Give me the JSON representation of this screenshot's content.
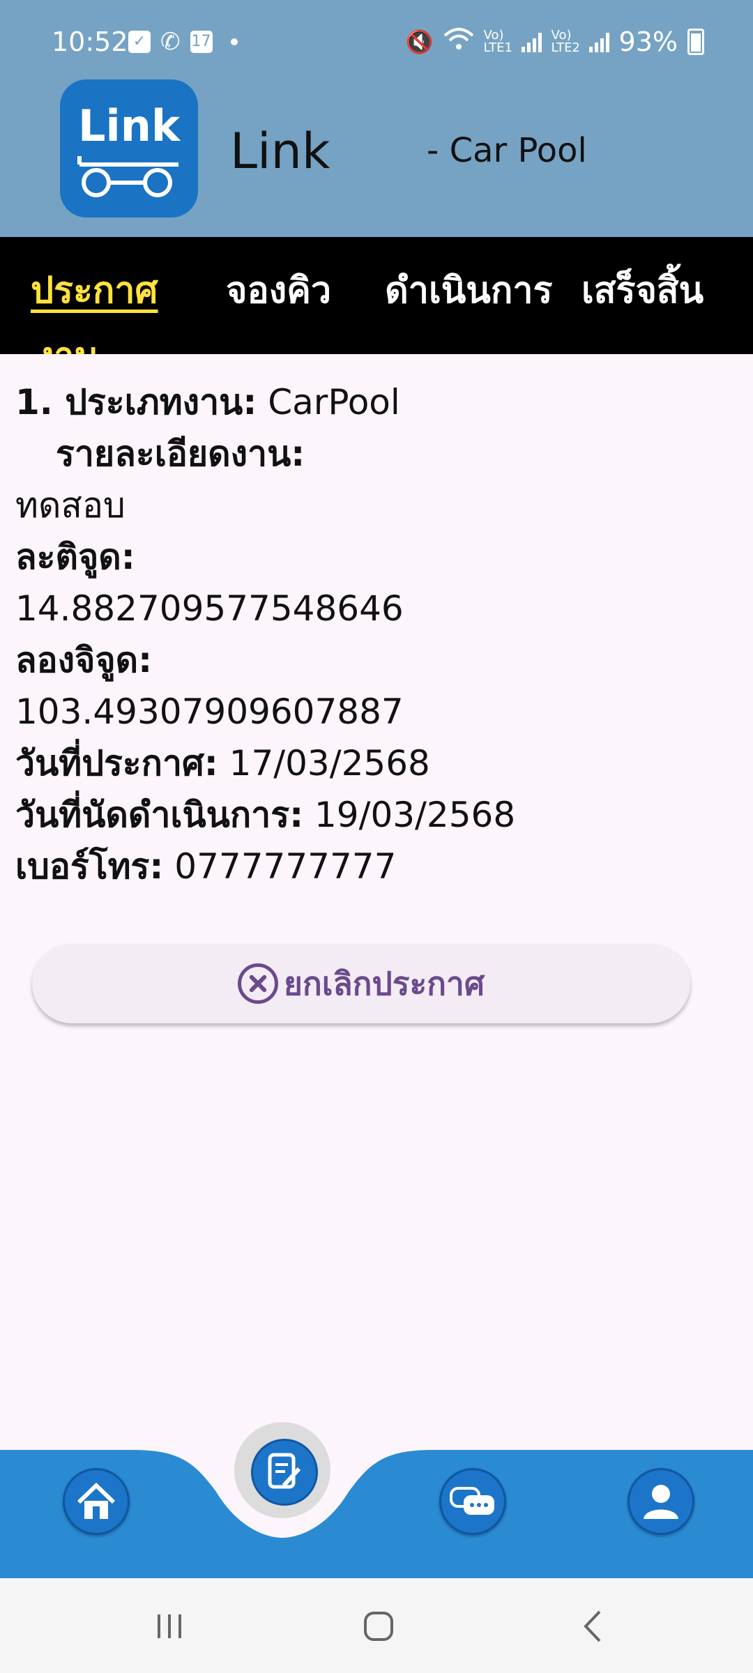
{
  "status_bar": {
    "time": "10:52",
    "calendar_day": "17",
    "lte1": "Vo) LTE1",
    "lte2": "Vo) LTE2",
    "battery": "93%"
  },
  "header": {
    "logo_text": "Link",
    "app_name": "Link",
    "subtitle": "- Car Pool"
  },
  "tabs": {
    "items": [
      {
        "label": "ประกาศ",
        "active": true
      },
      {
        "label": "จองคิว",
        "active": false
      },
      {
        "label": "ดำเนินการ",
        "active": false
      },
      {
        "label": "เสร็จสิ้น",
        "active": false
      }
    ],
    "overflow_text": "งาน"
  },
  "detail": {
    "job_type_label": "1. ประเภทงาน:",
    "job_type_value": "CarPool",
    "job_detail_label": "รายละเอียดงาน:",
    "job_detail_value": "ทดสอบ",
    "latitude_label": "ละติจูด:",
    "latitude_value": "14.882709577548646",
    "longitude_label": "ลองจิจูด:",
    "longitude_value": "103.49307909607887",
    "announce_date_label": "วันที่ประกาศ:",
    "announce_date_value": "17/03/2568",
    "appointment_date_label": "วันที่นัดดำเนินการ:",
    "appointment_date_value": "19/03/2568",
    "phone_label": "เบอร์โทร:",
    "phone_value": "0777777777"
  },
  "cancel_button": {
    "label": "ยกเลิกประกาศ"
  },
  "bottom_nav": {
    "items": [
      "home-icon",
      "edit-document-icon",
      "chat-icon",
      "profile-icon"
    ],
    "accent": "#2a8bd3"
  },
  "colors": {
    "header_bg": "#76a3c3",
    "tab_bg": "#000000",
    "active_tab": "#ffe23c",
    "page_bg": "#fcf5fc",
    "button_text": "#6a4a8c"
  }
}
